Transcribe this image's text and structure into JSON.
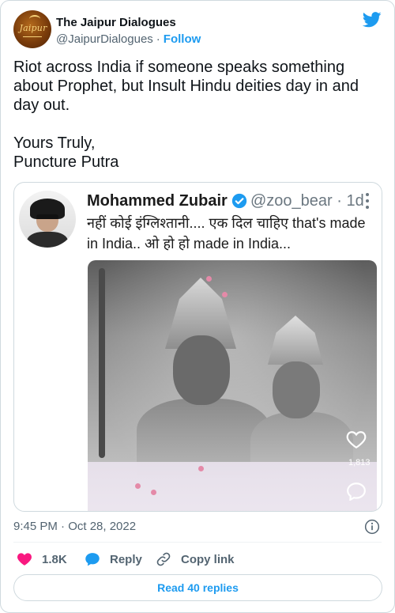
{
  "author": {
    "display_name": "The Jaipur Dialogues",
    "handle": "@JaipurDialogues",
    "follow_label": "Follow",
    "avatar_logo_text": "Jaipur"
  },
  "tweet": {
    "text": "Riot across India if someone speaks something about Prophet, but Insult Hindu deities day in and day out.\n\nYours Truly,\nPuncture Putra",
    "timestamp": "9:45 PM · Oct 28, 2022"
  },
  "quoted_media": {
    "name": "Mohammed Zubair",
    "handle_time": "@zoo_bear · 1d",
    "text": "नहीं कोई इंग्लिश्तानी.... एक दिल चाहिए that's made in India.. ओ हो हो made in India...",
    "like_count": "1,813"
  },
  "actions": {
    "like_count": "1.8K",
    "reply_label": "Reply",
    "copy_label": "Copy link",
    "read_replies_label": "Read 40 replies"
  },
  "colors": {
    "accent": "#1d9bf0",
    "like": "#f91880",
    "text": "#0f1419",
    "muted": "#536471"
  }
}
